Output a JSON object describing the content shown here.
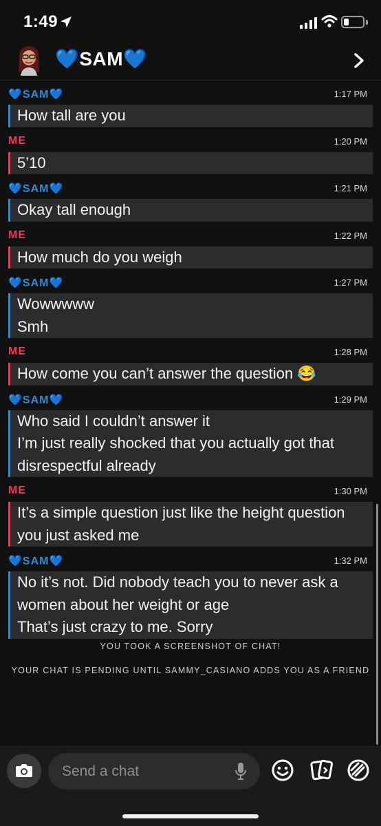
{
  "status_bar": {
    "time": "1:49"
  },
  "header": {
    "contact_name": "💙SAM💙"
  },
  "messages": [
    {
      "sender": "💙SAM💙",
      "time": "1:17 PM",
      "lines": [
        "How tall are you"
      ]
    },
    {
      "sender": "ME",
      "time": "1:20 PM",
      "lines": [
        "5’10"
      ]
    },
    {
      "sender": "💙SAM💙",
      "time": "1:21 PM",
      "lines": [
        "Okay tall enough"
      ]
    },
    {
      "sender": "ME",
      "time": "1:22 PM",
      "lines": [
        "How much do you weigh"
      ]
    },
    {
      "sender": "💙SAM💙",
      "time": "1:27 PM",
      "lines": [
        "Wowwwww",
        "Smh"
      ]
    },
    {
      "sender": "ME",
      "time": "1:28 PM",
      "lines": [
        "How come you can’t answer the question 😂"
      ]
    },
    {
      "sender": "💙SAM💙",
      "time": "1:29 PM",
      "lines": [
        "Who said I couldn’t answer it",
        "I’m just really shocked that you actually got that",
        "disrespectful already"
      ]
    },
    {
      "sender": "ME",
      "time": "1:30 PM",
      "lines": [
        "It’s a simple question just like the height question",
        "you just asked me"
      ]
    },
    {
      "sender": "💙SAM💙",
      "time": "1:32 PM",
      "lines": [
        "No it’s not. Did nobody teach you to never ask a",
        "women about her weight or age",
        "That’s just crazy to me. Sorry"
      ]
    }
  ],
  "notices": {
    "screenshot": "YOU TOOK A SCREENSHOT OF CHAT!",
    "pending": "YOUR CHAT IS PENDING UNTIL SAMMY_CASIANO ADDS YOU AS A FRIEND"
  },
  "composer": {
    "placeholder": "Send a chat"
  },
  "icons": [
    "location-arrow-icon",
    "signal-icon",
    "wifi-icon",
    "battery-icon",
    "chevron-right-icon",
    "camera-icon",
    "microphone-icon",
    "smiley-icon",
    "sticker-cards-icon",
    "rocket-game-icon"
  ],
  "colors": {
    "them": "#2f8dd6",
    "me": "#f23c57",
    "bubble": "#2c2c2e",
    "background": "#111112"
  }
}
